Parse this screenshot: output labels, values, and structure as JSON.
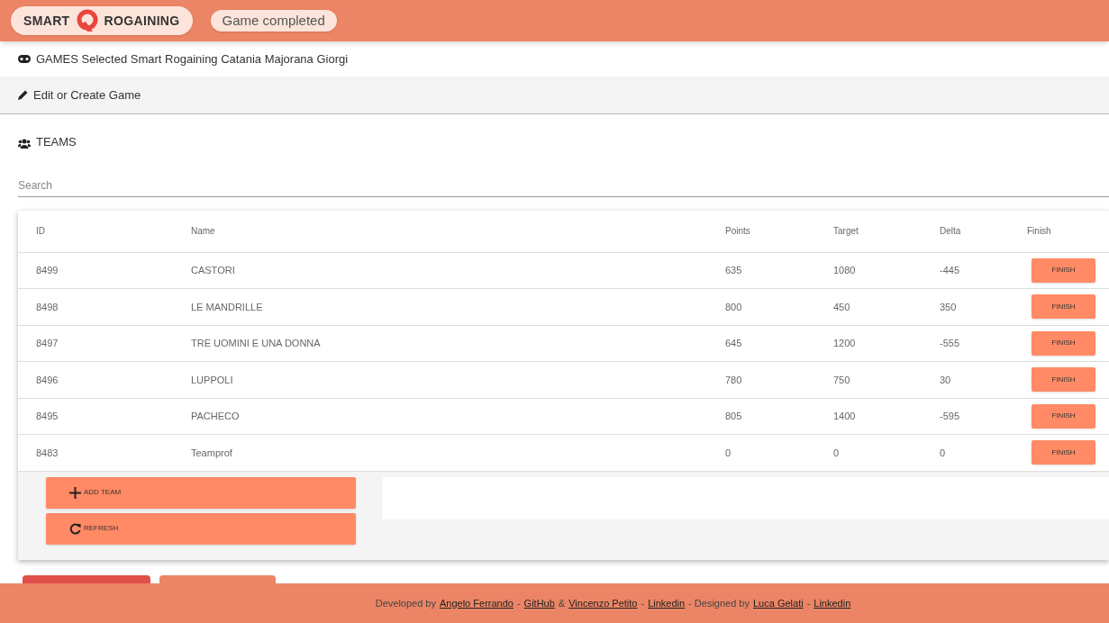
{
  "header": {
    "logo": {
      "left": "SMART",
      "right": "ROGAINING"
    },
    "status": "Game completed"
  },
  "games_bar": {
    "text": "GAMES Selected Smart Rogaining Catania Majorana Giorgi"
  },
  "edit_bar": {
    "text": "Edit or Create Game"
  },
  "teams": {
    "title": "TEAMS",
    "search": {
      "placeholder": "Search"
    },
    "table": {
      "columns": [
        "ID",
        "Name",
        "Points",
        "Target",
        "Delta",
        "Finish"
      ],
      "rows": [
        {
          "id": "8499",
          "name": "CASTORI",
          "points": "635",
          "target": "1080",
          "delta": "-445",
          "action": "FINISH"
        },
        {
          "id": "8498",
          "name": "LE MANDRILLE",
          "points": "800",
          "target": "450",
          "delta": "350",
          "action": "FINISH"
        },
        {
          "id": "8497",
          "name": "TRE UOMINI E UNA DONNA",
          "points": "645",
          "target": "1200",
          "delta": "-555",
          "action": "FINISH"
        },
        {
          "id": "8496",
          "name": "LUPPOLI",
          "points": "780",
          "target": "750",
          "delta": "30",
          "action": "FINISH"
        },
        {
          "id": "8495",
          "name": "PACHECO",
          "points": "805",
          "target": "1400",
          "delta": "-595",
          "action": "FINISH"
        },
        {
          "id": "8483",
          "name": "Teamprof",
          "points": "0",
          "target": "0",
          "delta": "0",
          "action": "FINISH"
        }
      ]
    },
    "buttons": [
      {
        "kind": "add",
        "label": "ADD TEAM"
      },
      {
        "kind": "refresh",
        "label": "REFRESH"
      }
    ]
  },
  "footer": [
    {
      "text": "Developed by",
      "link": false
    },
    {
      "text": "Angelo Ferrando",
      "link": true
    },
    {
      "text": "-",
      "link": false
    },
    {
      "text": "GitHub",
      "link": true
    },
    {
      "text": "&",
      "link": false
    },
    {
      "text": "Vincenzo Petito",
      "link": true
    },
    {
      "text": "-",
      "link": false
    },
    {
      "text": "Linkedin",
      "link": true
    },
    {
      "text": "- Designed by",
      "link": false
    },
    {
      "text": "Luca Gelati",
      "link": true
    },
    {
      "text": "-",
      "link": false
    },
    {
      "text": "Linkedin",
      "link": true
    }
  ]
}
